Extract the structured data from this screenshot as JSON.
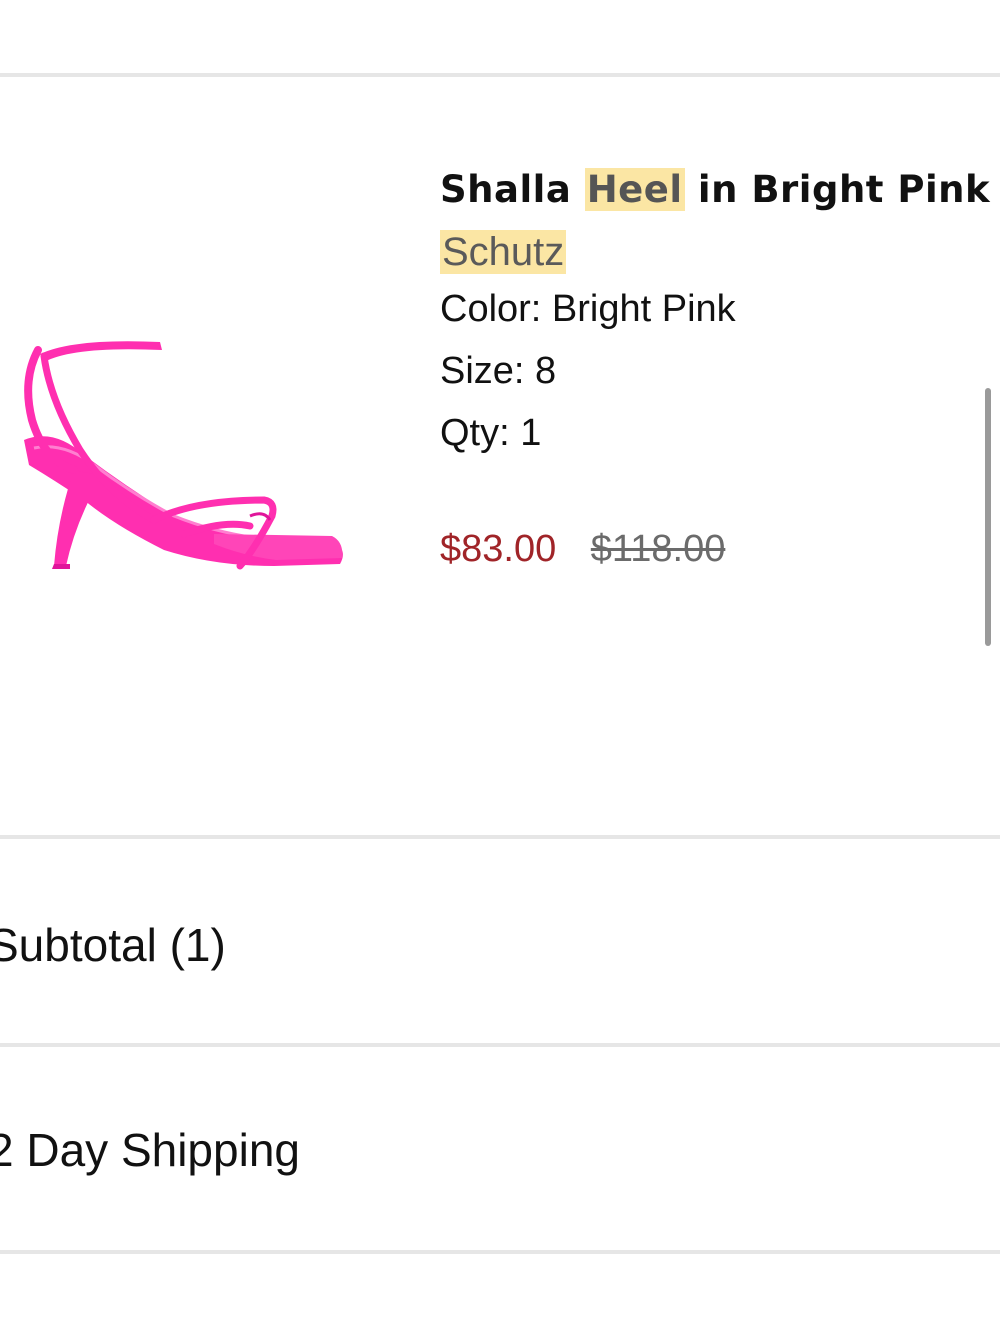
{
  "product": {
    "title_prefix": "Shalla",
    "title_highlight": "Heel",
    "title_suffix": "in Bright Pink",
    "brand": "Schutz",
    "color_line": "Color: Bright Pink",
    "size_line": "Size: 8",
    "qty_line": "Qty: 1",
    "sale_price": "$83.00",
    "original_price": "$118.00",
    "image_icon": "pink-strappy-heel-sandal",
    "colors": {
      "sale_price": "#a02428",
      "highlight": "#fbe6a4",
      "shoe": "#ff2fb0"
    }
  },
  "summary": {
    "subtotal_label": "Subtotal (1)",
    "shipping_label": "2 Day Shipping"
  }
}
